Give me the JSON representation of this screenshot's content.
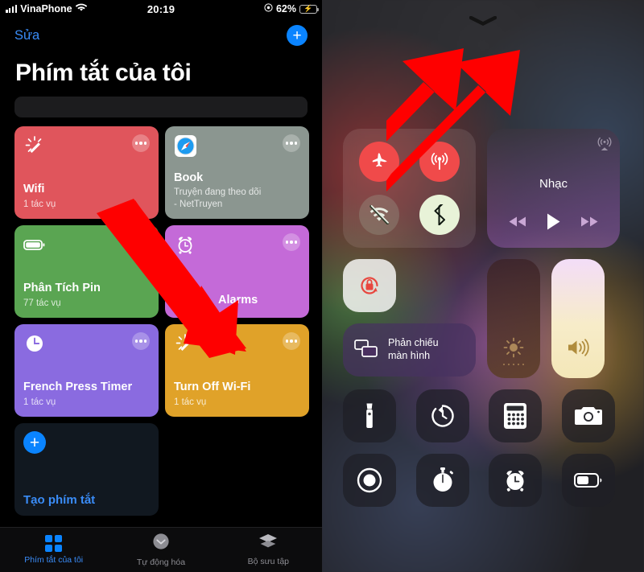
{
  "status_bar": {
    "carrier": "VinaPhone",
    "time": "20:19",
    "battery_percent": "62%",
    "signal_icon": "cellular-signal-icon",
    "wifi_icon": "wifi-icon",
    "lock_icon": "orientation-lock-icon",
    "battery_icon": "battery-charging-icon"
  },
  "shortcuts_app": {
    "edit_label": "Sửa",
    "add_label": "+",
    "page_title": "Phím tắt của tôi",
    "search_placeholder": "",
    "search_value": "",
    "cards": [
      {
        "name": "Wifi",
        "subtitle": "1 tác vụ",
        "color": "#e0555c",
        "icon": "magic-wand-icon"
      },
      {
        "name": "Book",
        "subtitle": "Truyện đang theo dõi\n- NetTruyen",
        "color": "#8b9690",
        "icon": "safari-compass-icon"
      },
      {
        "name": "Phân Tích Pin",
        "subtitle": "77 tác vụ",
        "color": "#5aa552",
        "icon": "battery-icon"
      },
      {
        "name": "Alarms",
        "subtitle": "",
        "color": "#c46ad8",
        "icon": "alarm-clock-icon"
      },
      {
        "name": "French Press Timer",
        "subtitle": "1 tác vụ",
        "color": "#8a6be0",
        "icon": "clock-icon"
      },
      {
        "name": "Turn Off Wi-Fi",
        "subtitle": "1 tác vụ",
        "color": "#e0a229",
        "icon": "magic-wand-icon"
      }
    ],
    "create_card": {
      "label": "Tạo phím tắt",
      "icon": "plus-icon"
    },
    "tabs": [
      {
        "label": "Phím tắt của tôi",
        "icon": "grid-icon",
        "active": true
      },
      {
        "label": "Tự động hóa",
        "icon": "automation-clock-icon",
        "active": false
      },
      {
        "label": "Bộ sưu tập",
        "icon": "layers-icon",
        "active": false
      }
    ]
  },
  "control_center": {
    "chevron_icon": "chevron-down-icon",
    "connectivity": [
      {
        "name": "Chế độ máy bay",
        "icon": "airplane-icon",
        "state": "on"
      },
      {
        "name": "Dữ liệu di động",
        "icon": "cellular-data-icon",
        "state": "on"
      },
      {
        "name": "Wi-Fi",
        "icon": "wifi-off-icon",
        "state": "off"
      },
      {
        "name": "Bluetooth",
        "icon": "bluetooth-icon",
        "state": "on"
      }
    ],
    "media": {
      "title": "Nhạc",
      "airplay_icon": "airplay-icon",
      "controls": [
        "rewind-icon",
        "play-icon",
        "fast-forward-icon"
      ]
    },
    "rotation_lock": {
      "name": "Khóa xoay",
      "icon": "rotation-lock-icon",
      "state": "on"
    },
    "screen_mirroring": {
      "label": "Phản chiếu\nmàn hình",
      "icon": "screen-mirroring-icon"
    },
    "brightness_slider": {
      "name": "Độ sáng",
      "icon": "brightness-icon"
    },
    "volume_slider": {
      "name": "Âm lượng",
      "icon": "volume-icon"
    },
    "app_tiles_row1": [
      {
        "name": "Đèn pin",
        "icon": "flashlight-icon"
      },
      {
        "name": "Hẹn giờ",
        "icon": "timer-icon"
      },
      {
        "name": "Máy tính",
        "icon": "calculator-icon"
      },
      {
        "name": "Máy ảnh",
        "icon": "camera-icon"
      }
    ],
    "app_tiles_row2": [
      {
        "name": "Quay màn hình",
        "icon": "screen-record-icon"
      },
      {
        "name": "Bấm giờ",
        "icon": "stopwatch-icon"
      },
      {
        "name": "Báo thức",
        "icon": "alarm-icon"
      },
      {
        "name": "Chế độ nguồn điện thấp",
        "icon": "low-power-battery-icon"
      }
    ]
  },
  "annotations": {
    "arrow_color": "#fe0000",
    "arrows": [
      {
        "name": "arrow-pointing-to-turn-off-wifi-shortcut",
        "direction": "down-right"
      },
      {
        "name": "arrow-pointing-to-wifi-toggle",
        "direction": "up-left"
      }
    ]
  }
}
